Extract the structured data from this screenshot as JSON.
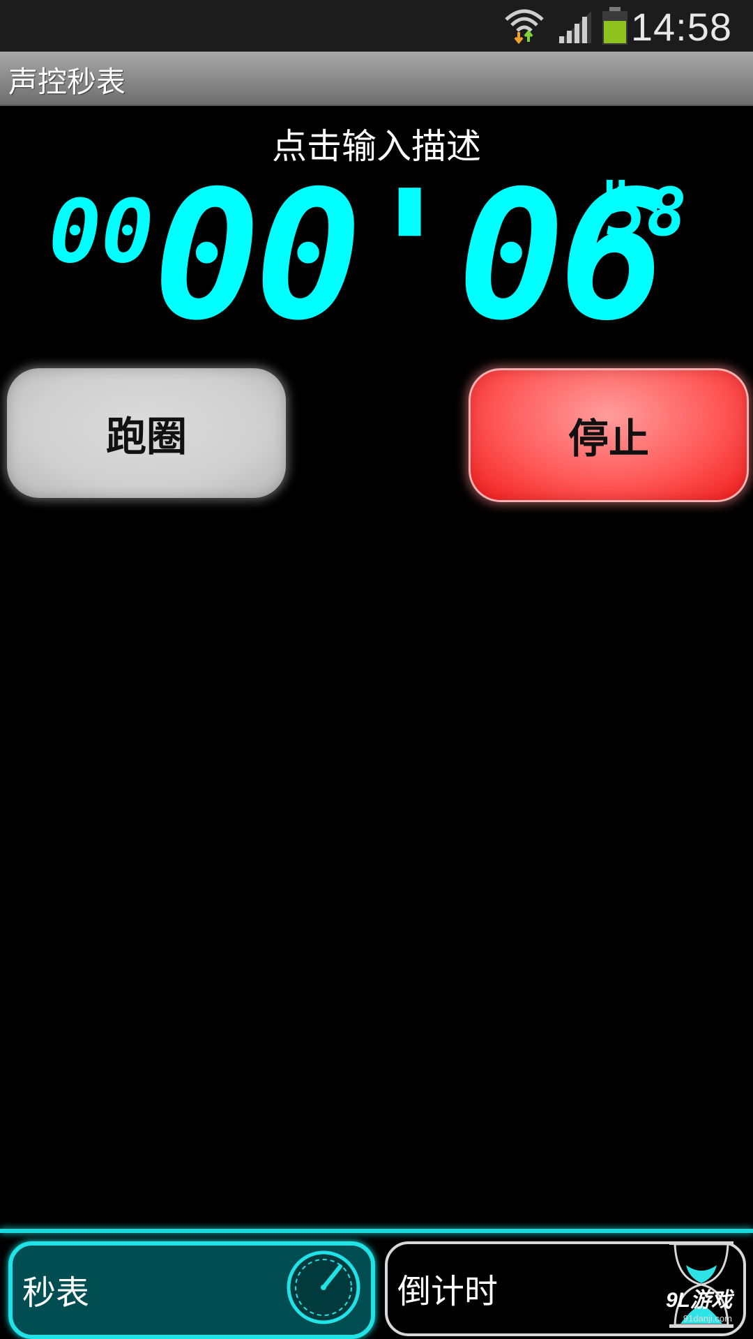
{
  "status_bar": {
    "time": "14:58",
    "wifi_icon": "wifi-icon",
    "signal_icon": "signal-icon",
    "battery_icon": "battery-icon",
    "battery_color": "#8ec21f"
  },
  "app": {
    "title": "声控秒表"
  },
  "main": {
    "description": "点击输入描述",
    "timer": {
      "hours": "00:",
      "minutes_seconds": "00'06",
      "centiseconds_mark": "\"",
      "centiseconds": "58",
      "color": "#00ffff"
    },
    "buttons": {
      "lap_label": "跑圈",
      "stop_label": "停止"
    }
  },
  "tabs": [
    {
      "label": "秒表",
      "icon": "stopwatch-icon",
      "selected": true
    },
    {
      "label": "倒计时",
      "icon": "hourglass-icon",
      "selected": false
    }
  ],
  "watermark": {
    "main": "9L游戏",
    "sub": "91danji.com"
  }
}
